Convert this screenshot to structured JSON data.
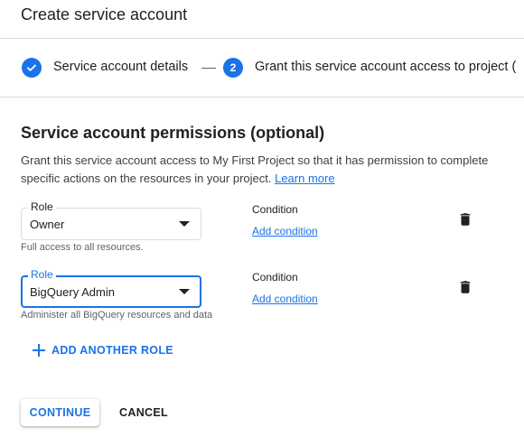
{
  "header": {
    "title": "Create service account"
  },
  "stepper": {
    "steps": [
      {
        "label": "Service account details",
        "state": "completed"
      },
      {
        "label": "Grant this service account access to project (",
        "number": "2",
        "state": "active"
      }
    ],
    "separator": "—"
  },
  "section": {
    "title": "Service account permissions (optional)",
    "description": "Grant this service account access to My First Project so that it has permission to complete specific actions on the resources in your project.",
    "learn_more": "Learn more"
  },
  "roles": [
    {
      "field_label": "Role",
      "value": "Owner",
      "hint": "Full access to all resources.",
      "condition_label": "Condition",
      "condition_link": "Add condition",
      "focused": false
    },
    {
      "field_label": "Role",
      "value": "BigQuery Admin",
      "hint": "Administer all BigQuery resources and data",
      "condition_label": "Condition",
      "condition_link": "Add condition",
      "focused": true
    }
  ],
  "add_role_label": "ADD ANOTHER ROLE",
  "actions": {
    "continue_label": "CONTINUE",
    "cancel_label": "CANCEL"
  },
  "colors": {
    "accent": "#1a73e8",
    "text": "#202124",
    "secondary_text": "#5f6368",
    "divider": "#dadce0"
  },
  "icons": {
    "step_complete": "check-circle-icon",
    "delete": "trash-icon",
    "add": "plus-icon",
    "dropdown": "caret-down-icon"
  }
}
